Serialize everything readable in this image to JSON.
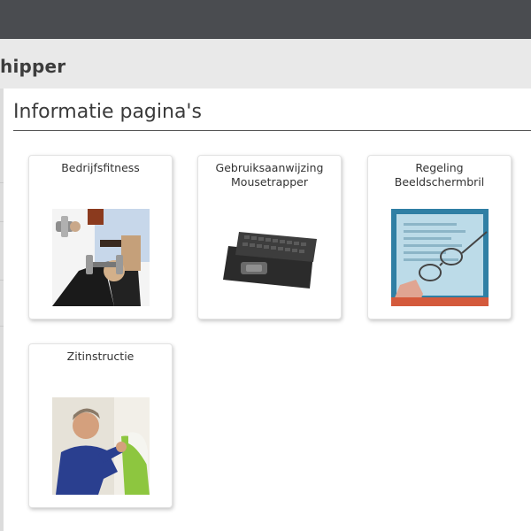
{
  "header": {
    "title": "hipper"
  },
  "page": {
    "heading": "Informatie pagina's"
  },
  "cards": [
    {
      "label": "Bedrijfsfitness",
      "image": "fitness-photo"
    },
    {
      "label": "Gebruiksaanwijzing\nMousetrapper",
      "image": "keyboard-photo"
    },
    {
      "label": "Regeling\nBeeldschermbril",
      "image": "glasses-photo"
    },
    {
      "label": "Zitinstructie",
      "image": "seating-photo"
    }
  ]
}
